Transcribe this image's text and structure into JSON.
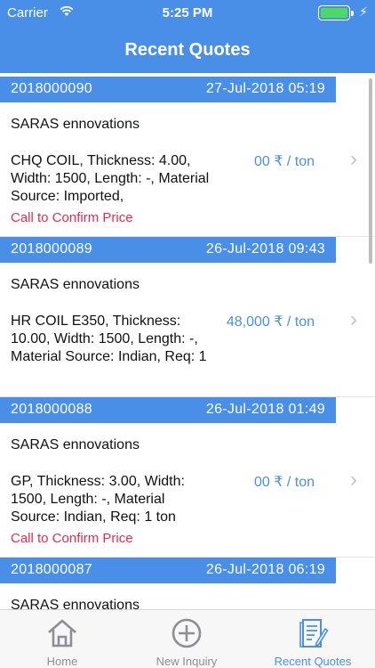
{
  "status_bar": {
    "carrier": "Carrier",
    "time": "5:25 PM",
    "icons": [
      "wifi-icon",
      "battery-icon",
      "charging-bolt-icon"
    ]
  },
  "nav": {
    "title": "Recent Quotes"
  },
  "colors": {
    "accent": "#4a8fe7",
    "alert": "#e8294f",
    "chevron": "#c2c2c7"
  },
  "quotes": [
    {
      "id": "2018000090",
      "date": "27-Jul-2018 05:19",
      "company": "SARAS ennovations",
      "description": "CHQ COIL, Thickness: 4.00, Width: 1500, Length: -, Material Source: Imported,",
      "price": "00 ₹ / ton",
      "call_to_confirm": "Call to Confirm Price"
    },
    {
      "id": "2018000089",
      "date": "26-Jul-2018 09:43",
      "company": "SARAS ennovations",
      "description": "HR COIL E350, Thickness: 10.00, Width: 1500, Length: -, Material Source: Indian, Req: 1",
      "price": "48,000 ₹ / ton",
      "call_to_confirm": ""
    },
    {
      "id": "2018000088",
      "date": "26-Jul-2018 01:49",
      "company": "SARAS ennovations",
      "description": "GP, Thickness: 3.00, Width: 1500, Length: -, Material Source: Indian, Req: 1 ton",
      "price": "00 ₹ / ton",
      "call_to_confirm": "Call to Confirm Price"
    },
    {
      "id": "2018000087",
      "date": "26-Jul-2018 06:19",
      "company": "SARAS ennovations",
      "description": "",
      "price": "",
      "call_to_confirm": ""
    }
  ],
  "tabs": [
    {
      "label": "Home",
      "icon": "home-icon",
      "active": false
    },
    {
      "label": "New Inquiry",
      "icon": "plus-circle-icon",
      "active": false
    },
    {
      "label": "Recent Quotes",
      "icon": "quotes-document-icon",
      "active": true
    }
  ]
}
